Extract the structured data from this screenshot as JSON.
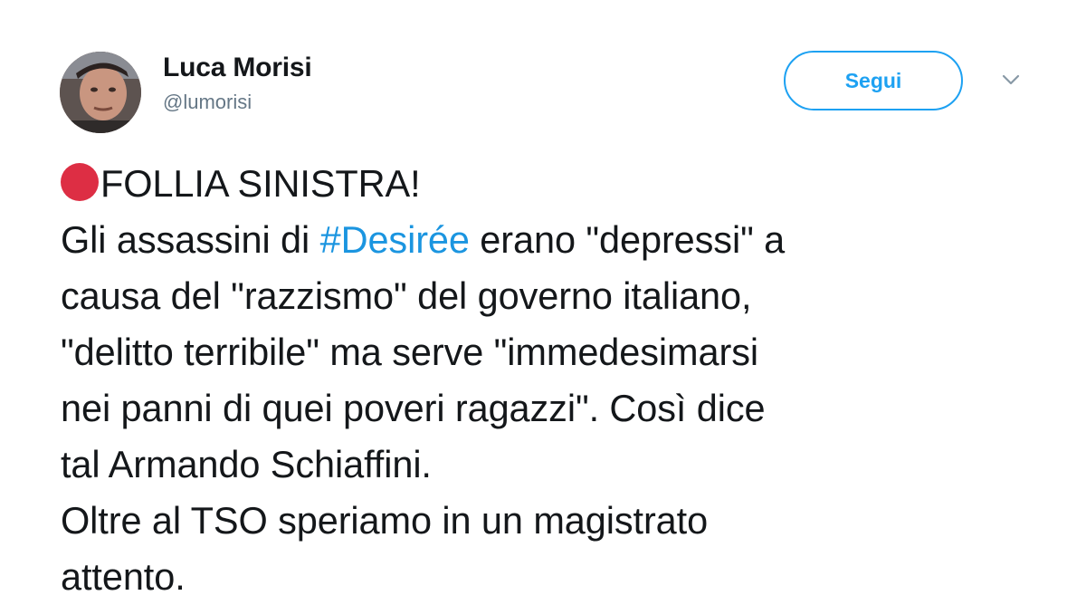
{
  "user": {
    "name": "Luca Morisi",
    "handle": "@lumorisi",
    "avatar_icon": "profile-photo"
  },
  "follow": {
    "label": "Segui",
    "color": "#1da1f2"
  },
  "menu": {
    "icon": "chevron-down-icon"
  },
  "tweet": {
    "emoji_icon": "red-circle-icon",
    "emoji_color": "#dd2e44",
    "line1": "FOLLIA SINISTRA!",
    "line2_before": "Gli assassini di ",
    "hashtag": "#Desirée",
    "hashtag_color": "#1b95e0",
    "line2_after": " erano \"depressi\" a",
    "line3": "causa del \"razzismo\" del governo italiano,",
    "line4": "\"delitto terribile\" ma serve \"immedesimarsi",
    "line5": "nei panni di quei poveri ragazzi\". Così dice",
    "line6": "tal Armando Schiaffini.",
    "line7": "Oltre al TSO speriamo in un magistrato",
    "line8": "attento."
  }
}
